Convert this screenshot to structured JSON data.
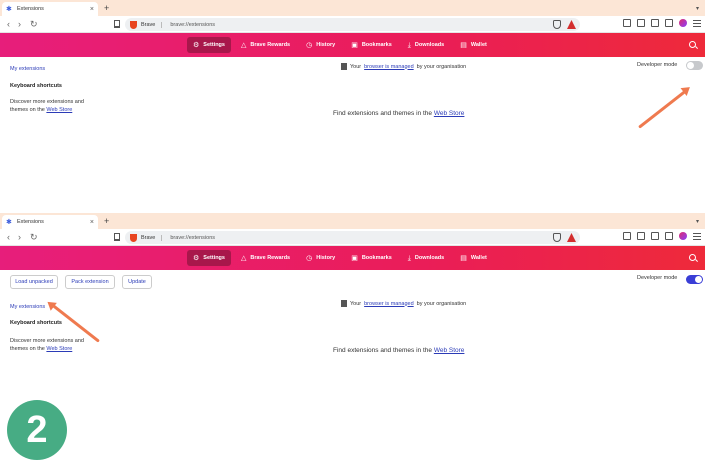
{
  "panels": [
    {
      "tab": {
        "title": "Extensions",
        "close": "×",
        "new_tab": "+"
      },
      "toolbar": {
        "brave_label": "Brave",
        "url": "brave://extensions"
      },
      "nav": [
        {
          "label": "Settings",
          "icon": "gear-icon",
          "glyph": "⚙",
          "active": true
        },
        {
          "label": "Brave Rewards",
          "icon": "rewards-triangle-icon",
          "glyph": "△"
        },
        {
          "label": "History",
          "icon": "history-clock-icon",
          "glyph": "◷"
        },
        {
          "label": "Bookmarks",
          "icon": "bookmarks-icon",
          "glyph": "▣"
        },
        {
          "label": "Downloads",
          "icon": "download-icon",
          "glyph": "⤓"
        },
        {
          "label": "Wallet",
          "icon": "wallet-icon",
          "glyph": "▤"
        }
      ],
      "developer_mode": {
        "label": "Developer mode",
        "on": false
      },
      "sidebar": {
        "my_extensions": "My extensions",
        "keyboard_shortcuts": "Keyboard shortcuts",
        "discover_prefix": "Discover more extensions and themes on the",
        "web_store": "Web Store"
      },
      "managed": {
        "prefix": "Your",
        "link": "browser is managed",
        "suffix": "by your organisation"
      },
      "find": {
        "prefix": "Find extensions and themes in the",
        "link": "Web Store"
      }
    },
    {
      "tab": {
        "title": "Extensions",
        "close": "×",
        "new_tab": "+"
      },
      "toolbar": {
        "brave_label": "Brave",
        "url": "brave://extensions"
      },
      "nav": [
        {
          "label": "Settings",
          "icon": "gear-icon",
          "glyph": "⚙",
          "active": true
        },
        {
          "label": "Brave Rewards",
          "icon": "rewards-triangle-icon",
          "glyph": "△"
        },
        {
          "label": "History",
          "icon": "history-clock-icon",
          "glyph": "◷"
        },
        {
          "label": "Bookmarks",
          "icon": "bookmarks-icon",
          "glyph": "▣"
        },
        {
          "label": "Downloads",
          "icon": "download-icon",
          "glyph": "⤓"
        },
        {
          "label": "Wallet",
          "icon": "wallet-icon",
          "glyph": "▤"
        }
      ],
      "developer_mode": {
        "label": "Developer mode",
        "on": true
      },
      "dev_buttons": [
        "Load unpacked",
        "Pack extension",
        "Update"
      ],
      "sidebar": {
        "my_extensions": "My extensions",
        "keyboard_shortcuts": "Keyboard shortcuts",
        "discover_prefix": "Discover more extensions and themes on the",
        "web_store": "Web Store"
      },
      "managed": {
        "prefix": "Your",
        "link": "browser is managed",
        "suffix": "by your organisation"
      },
      "find": {
        "prefix": "Find extensions and themes in the",
        "link": "Web Store"
      }
    }
  ],
  "step_badge": "2",
  "colors": {
    "nav_start": "#e71e7b",
    "nav_end": "#ee2a3a",
    "arrow": "#ef7a4f",
    "badge": "#47ac84",
    "toggle_on": "#3a3ed6"
  }
}
